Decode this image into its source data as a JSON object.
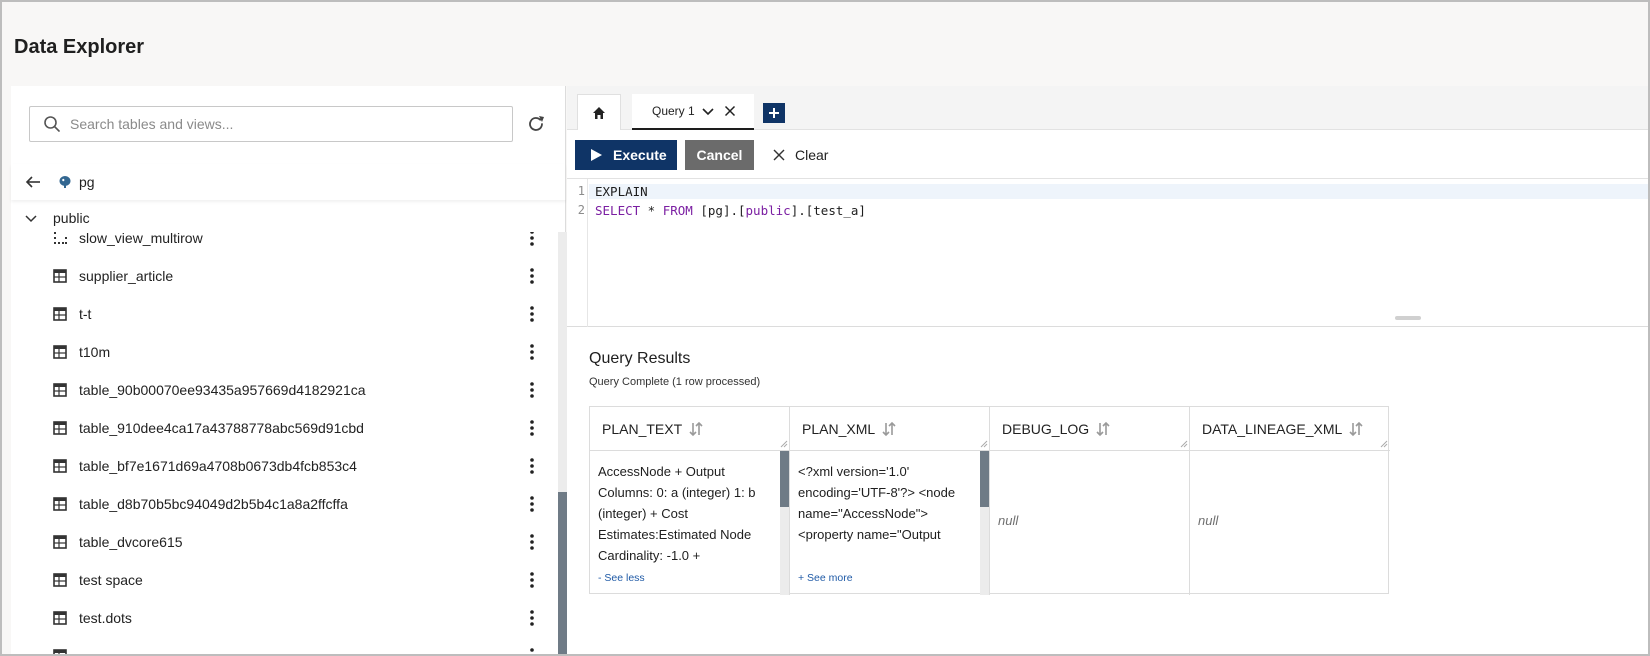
{
  "app": {
    "title": "Data Explorer"
  },
  "sidebar": {
    "search_placeholder": "Search tables and views...",
    "database": "pg",
    "schema": "public",
    "items": [
      {
        "label": "slow_view_multirow",
        "icon": "view-icon"
      },
      {
        "label": "supplier_article",
        "icon": "table-icon"
      },
      {
        "label": "t-t",
        "icon": "table-icon"
      },
      {
        "label": "t10m",
        "icon": "table-icon"
      },
      {
        "label": "table_90b00070ee93435a957669d4182921ca",
        "icon": "table-icon"
      },
      {
        "label": "table_910dee4ca17a43788778abc569d91cbd",
        "icon": "table-icon"
      },
      {
        "label": "table_bf7e1671d69a4708b0673db4fcb853c4",
        "icon": "table-icon"
      },
      {
        "label": "table_d8b70b5bc94049d2b5b4c1a8a2ffcffa",
        "icon": "table-icon"
      },
      {
        "label": "table_dvcore615",
        "icon": "table-icon"
      },
      {
        "label": "test space",
        "icon": "table-icon"
      },
      {
        "label": "test.dots",
        "icon": "table-icon"
      },
      {
        "label": "",
        "icon": "table-icon"
      }
    ]
  },
  "tabs": {
    "home_icon": "home-icon",
    "query_tab_label": "Query 1",
    "add_icon": "plus-icon"
  },
  "toolbar": {
    "execute_label": "Execute",
    "cancel_label": "Cancel",
    "clear_label": "Clear"
  },
  "editor": {
    "lines": [
      {
        "num": "1",
        "text": "EXPLAIN"
      },
      {
        "num": "2",
        "tokens": [
          {
            "t": "SELECT",
            "kw": true
          },
          {
            "t": " * ",
            "kw": false
          },
          {
            "t": "FROM",
            "kw": true
          },
          {
            "t": " [pg].[",
            "kw": false
          },
          {
            "t": "public",
            "kw": true
          },
          {
            "t": "].[test_a]",
            "kw": false
          }
        ]
      }
    ]
  },
  "results": {
    "title": "Query Results",
    "status": "Query Complete (1 row processed)",
    "columns": [
      "PLAN_TEXT",
      "PLAN_XML",
      "DEBUG_LOG",
      "DATA_LINEAGE_XML"
    ],
    "row": {
      "plan_text": "AccessNode + Output Columns: 0: a (integer) 1: b (integer) + Cost Estimates:Estimated Node Cardinality: -1.0 +",
      "plan_text_toggle": "- See less",
      "plan_xml": "<?xml version='1.0' encoding='UTF-8'?> <node name=\"AccessNode\"> <property name=\"Output",
      "plan_xml_toggle": "+ See more",
      "debug_log": "null",
      "data_lineage_xml": "null"
    }
  },
  "colors": {
    "primary": "#0f3466",
    "cancel": "#6b6b6b",
    "keyword": "#7b1fa2",
    "link": "#1f5aa6"
  }
}
